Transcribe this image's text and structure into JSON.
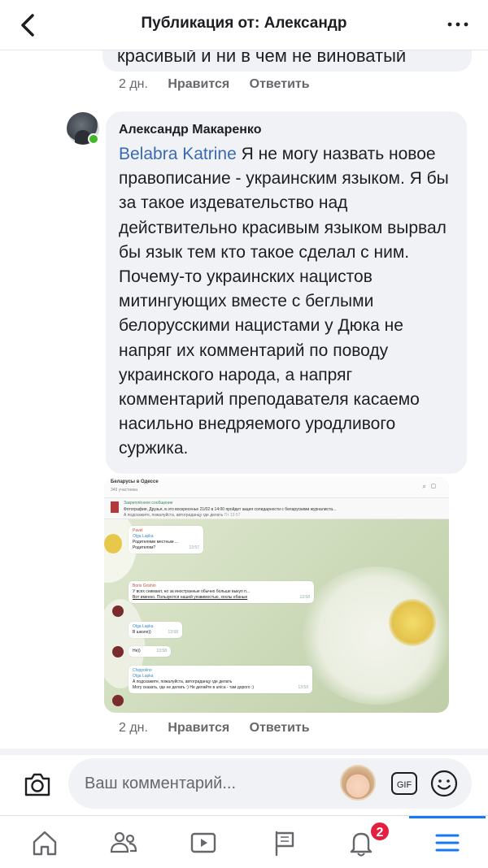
{
  "header": {
    "title": "Публикация от: Александр"
  },
  "previous_comment": {
    "visible_text": "красивый и ни в чем не виноватый",
    "time": "2 дн.",
    "like_label": "Нравится",
    "reply_label": "Ответить"
  },
  "comment": {
    "author": "Александр Макаренко",
    "mention": "Belabra Katrine",
    "text": " Я не могу назвать новое правописание - украинским языком. Я бы за такое издевательство над действительно красивым языком вырвал бы язык тем кто такое сделал с ним. Почему-то украинских нацистов митингующих вместе с беглыми белорусскими нацистами у Дюка не напряг их комментарий по поводу украинского народа, а напряг комментарий преподавателя касаемо насильно внедряемого уродливого суржика.",
    "time": "2 дн.",
    "like_label": "Нравится",
    "reply_label": "Ответить"
  },
  "attachment": {
    "chat_title": "Беларусы в Одессе",
    "chat_members": "349 участника",
    "pinned_title": "Закреплённое сообщение",
    "pinned_text": "Фотография, Друзья, в это воскресенье 21/02 в 14:00 пройдет акция солидарности с беларускими журналиста...",
    "pinned_text2": "А подскажите, пожалуйста, автограданцу где делать",
    "pinned_time": "Пт 13:57",
    "messages": [
      {
        "name": "Pavel",
        "reply_name": "Olga Lapka",
        "reply_text": "Родителями местным ...",
        "text": "Родителям?",
        "time": "13:57"
      },
      {
        "name": "Boris Grishin",
        "text": "У всех снимают, но за иностранные обычно больше выкуп п...",
        "text2": "Вот именно. Пользуются нашей уязвимостью, хохлы ебаные",
        "time": "13:58"
      },
      {
        "name": "Olga Lapka",
        "text": "В школе))",
        "time": "13:58"
      },
      {
        "name": "",
        "text": "Не))",
        "time": "13:58"
      },
      {
        "name": "Chippolino",
        "reply_name": "Olga Lapka",
        "reply_text": "А подскажите, пожалуйста, автограданцу где делать",
        "text": "Могу сказать, где не делать :) Не делайте в unica - там дорого :)",
        "time": "13:59"
      }
    ]
  },
  "composer": {
    "placeholder": "Ваш комментарий...",
    "gif_label": "GIF"
  },
  "bottom_nav": {
    "items": [
      "home",
      "friends",
      "watch",
      "pages",
      "notifications",
      "menu"
    ],
    "notification_count": "2",
    "active_item": "menu"
  },
  "colors": {
    "accent": "#1877f2",
    "bubble": "#f0f2f5",
    "mention": "#3a69b5",
    "badge": "#e41e3f",
    "online": "#42b72a"
  }
}
